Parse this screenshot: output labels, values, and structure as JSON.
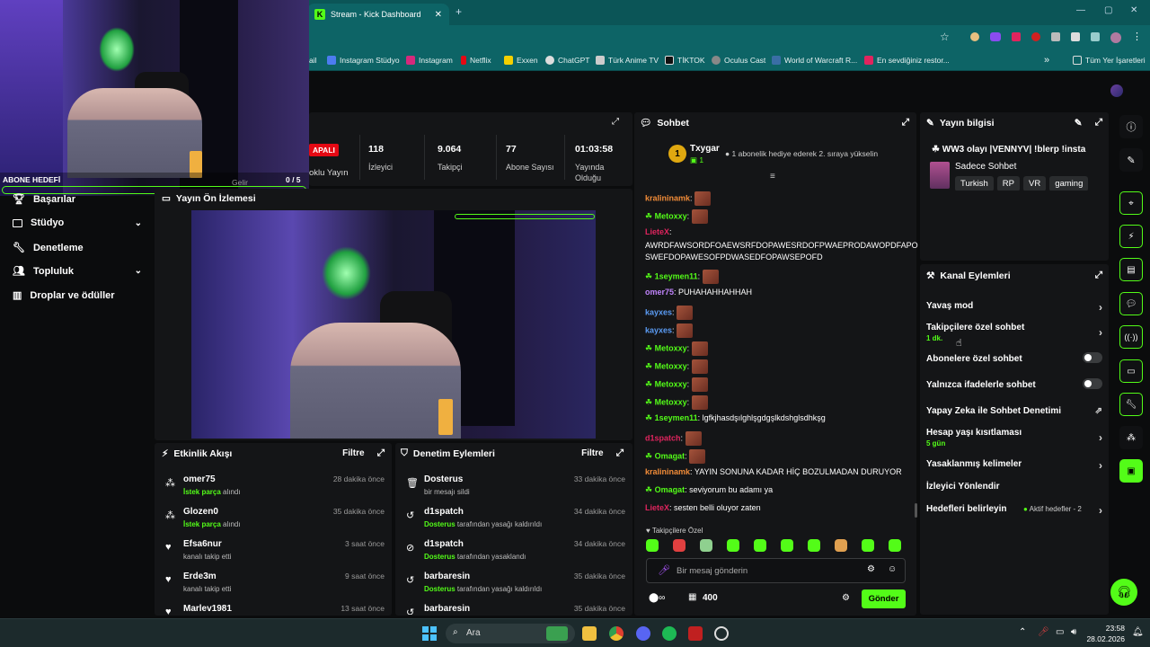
{
  "browser": {
    "tab_title": "Stream - Kick Dashboard",
    "bookmarks": [
      "ail",
      "Instagram Stüdyo",
      "Instagram",
      "Netflix",
      "Exxen",
      "ChatGPT",
      "Türk Anime TV",
      "TİKTOK",
      "Oculus Cast",
      "World of Warcraft R...",
      "En sevdiğiniz restor...",
      "Tüm Yer İşaretleri"
    ]
  },
  "webcam_overlay": {
    "goal_label": "ABONE HEDEFİ",
    "goal_value": "0 / 5"
  },
  "sidebar_nav": [
    {
      "label": "Başarılar",
      "icon": "trophy-icon"
    },
    {
      "label": "Stüdyo",
      "icon": "studio-icon",
      "expand": true
    },
    {
      "label": "Denetleme",
      "icon": "wrench-icon"
    },
    {
      "label": "Topluluk",
      "icon": "community-icon",
      "expand": true
    },
    {
      "label": "Droplar ve ödüller",
      "icon": "drops-icon"
    }
  ],
  "stats": {
    "live_badge": "APALI",
    "multi_label": "oklu Yayın",
    "viewers_value": "118",
    "viewers_label": "İzleyici",
    "followers_value": "9.064",
    "followers_label": "Takipçi",
    "subs_value": "77",
    "subs_label": "Abone Sayısı",
    "uptime_value": "01:03:58",
    "uptime_label": "Yayında Olduğu",
    "hidden_label": "Gelir"
  },
  "preview": {
    "title": "Yayın Ön İzlemesi"
  },
  "activity": {
    "title": "Etkinlik Akışı",
    "filter": "Filtre",
    "items": [
      {
        "name": "omer75",
        "hl": "İstek parça",
        "rest": " alındı",
        "time": "28 dakika önce",
        "icon": "request-icon"
      },
      {
        "name": "Glozen0",
        "hl": "İstek parça",
        "rest": " alındı",
        "time": "35 dakika önce",
        "icon": "request-icon"
      },
      {
        "name": "Efsa6nur",
        "hl": "",
        "rest": "kanalı takip etti",
        "time": "3 saat önce",
        "icon": "heart-icon"
      },
      {
        "name": "Erde3m",
        "hl": "",
        "rest": "kanalı takip etti",
        "time": "9 saat önce",
        "icon": "heart-icon"
      },
      {
        "name": "Marlev1981",
        "hl": "",
        "rest": "",
        "time": "13 saat önce",
        "icon": "heart-icon"
      }
    ]
  },
  "moderation": {
    "title": "Denetim Eylemleri",
    "filter": "Filtre",
    "items": [
      {
        "name": "Dosterus",
        "hl": "",
        "rest": "bir mesajı sildi",
        "time": "33 dakika önce",
        "icon": "trash-icon"
      },
      {
        "name": "d1spatch",
        "hl": "Dosterus",
        "rest": " tarafından yasağı kaldırıldı",
        "time": "34 dakika önce",
        "icon": "unban-icon"
      },
      {
        "name": "d1spatch",
        "hl": "Dosterus",
        "rest": " tarafından yasaklandı",
        "time": "34 dakika önce",
        "icon": "ban-icon"
      },
      {
        "name": "barbaresin",
        "hl": "Dosterus",
        "rest": " tarafından yasağı kaldırıldı",
        "time": "35 dakika önce",
        "icon": "unban-icon"
      },
      {
        "name": "barbaresin",
        "hl": "",
        "rest": "",
        "time": "35 dakika önce",
        "icon": "unban-icon"
      }
    ]
  },
  "chat": {
    "title": "Sohbet",
    "gifter": {
      "name": "Txygar",
      "rank": "1",
      "count": "1",
      "message": "1 abonelik hediye ederek 2. sıraya yükselin"
    },
    "messages": [
      {
        "user": "kralininamk",
        "color": "#f28c38",
        "text": "",
        "emotes": 1
      },
      {
        "user": "Metoxxy",
        "color": "#53fc18",
        "text": "",
        "emotes": 1
      },
      {
        "user": "LieteX",
        "color": "#e0245e",
        "text": "",
        "emotes": 0
      },
      {
        "user": "",
        "color": "#fff",
        "text": "AWRDFAWSORDFOAEWSRFDOPAWESRDOFPWAEPRODAWOPDFAPO",
        "emotes": 0
      },
      {
        "user": "",
        "color": "#fff",
        "text": "SWEFDOPAWESOFPDWASEDFOPAWSEPOFD",
        "emotes": 0
      },
      {
        "user": "1seymen11",
        "color": "#53fc18",
        "text": "",
        "emotes": 1
      },
      {
        "user": "omer75",
        "color": "#c084fc",
        "text": "PUHAHAHHAHHAH",
        "emotes": 0
      },
      {
        "user": "kayxes",
        "color": "#5b9cf5",
        "text": "",
        "emotes": 1
      },
      {
        "user": "kayxes",
        "color": "#5b9cf5",
        "text": "",
        "emotes": 1
      },
      {
        "user": "Metoxxy",
        "color": "#53fc18",
        "text": "",
        "emotes": 1
      },
      {
        "user": "Metoxxy",
        "color": "#53fc18",
        "text": "",
        "emotes": 1
      },
      {
        "user": "Metoxxy",
        "color": "#53fc18",
        "text": "",
        "emotes": 1
      },
      {
        "user": "Metoxxy",
        "color": "#53fc18",
        "text": "",
        "emotes": 1
      },
      {
        "user": "1seymen11",
        "color": "#53fc18",
        "text": "lgfkjhasdşılghlşgdgşlkdshglsdhkşg",
        "emotes": 0
      },
      {
        "user": "d1spatch",
        "color": "#e0245e",
        "text": "",
        "emotes": 1
      },
      {
        "user": "Omagat",
        "color": "#53fc18",
        "text": "",
        "emotes": 1
      },
      {
        "user": "kralininamk",
        "color": "#f28c38",
        "text": "YAYIN SONUNA KADAR HİÇ BOZULMADAN DURUYOR",
        "emotes": 0
      },
      {
        "user": "Omagat",
        "color": "#53fc18",
        "text": "seviyorum bu adamı ya",
        "emotes": 0
      },
      {
        "user": "LieteX",
        "color": "#e0245e",
        "text": "sesten belli oluyor zaten",
        "emotes": 0
      }
    ],
    "followers_only": "Takipçilere Özel",
    "input_placeholder": "Bir mesaj gönderin",
    "points": "400",
    "send": "Gönder"
  },
  "stream_info": {
    "title": "Yayın bilgisi",
    "stream_title": "WW3 olayı |VENNYV| !blerp !insta",
    "category": "Sadece Sohbet",
    "tags": [
      "Turkish",
      "RP",
      "VR",
      "gaming"
    ]
  },
  "channel_actions": {
    "title": "Kanal Eylemleri",
    "slow_mode": "Yavaş mod",
    "followers_chat": "Takipçilere özel sohbet",
    "followers_chat_sub": "1 dk.",
    "subs_chat": "Abonelere özel sohbet",
    "emote_chat": "Yalnızca ifadelerle sohbet",
    "ai_mod": "Yapay Zeka ile Sohbet Denetimi",
    "account_age": "Hesap yaşı kısıtlaması",
    "account_age_sub": "5 gün",
    "banned_words": "Yasaklanmış kelimeler",
    "raid": "İzleyici Yönlendir",
    "goals": "Hedefleri belirleyin",
    "goals_status": "Aktif hedefler - 2"
  },
  "taskbar": {
    "search": "Ara",
    "time": "23:58",
    "date": "28.02.2026"
  },
  "colors": {
    "accent": "#53fc18",
    "panel": "#141517",
    "bg": "#0b0c0d",
    "browser": "#0d6466"
  }
}
